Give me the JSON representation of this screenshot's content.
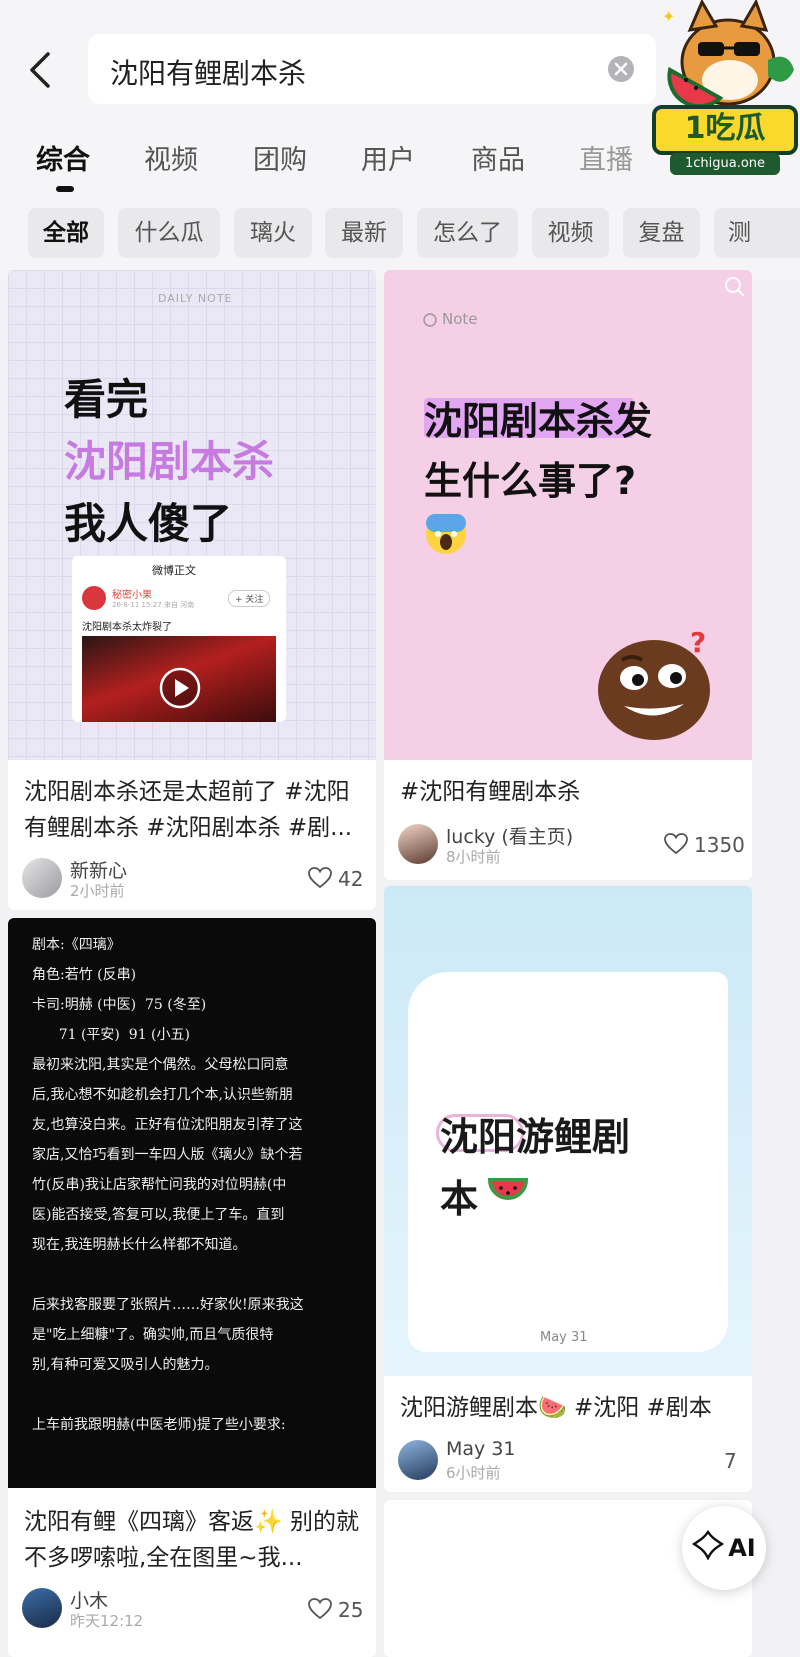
{
  "search": {
    "query": "沈阳有鲤剧本杀"
  },
  "tabs": [
    "综合",
    "视频",
    "团购",
    "用户",
    "商品",
    "直播"
  ],
  "chips": [
    "全部",
    "什么瓜",
    "璃火",
    "最新",
    "怎么了",
    "视频",
    "复盘",
    "测"
  ],
  "logo": {
    "text": "1吃瓜",
    "sub": "1chigua.one"
  },
  "card1": {
    "daily": "DAILY NOTE",
    "line1": "看完",
    "line2": "沈阳剧本杀",
    "line3": "我人傻了",
    "screenshot_header": "微博正文",
    "screenshot_user": "秘密小果",
    "screenshot_meta": "26-8-11 15:27 来自 河南",
    "screenshot_follow": "+ 关注",
    "screenshot_post": "沈阳剧本杀太炸裂了",
    "title": "沈阳剧本杀还是太超前了 #沈阳有鲤剧本杀 #沈阳剧本杀 #剧...",
    "user": "新新心",
    "time": "2小时前",
    "likes": "42"
  },
  "card2": {
    "note": "Note",
    "line1": "沈阳剧本杀发",
    "line2": "生什么事了?",
    "title": "#沈阳有鲤剧本杀",
    "user": "lucky (看主页)",
    "time": "8小时前",
    "likes": "1350"
  },
  "card3": {
    "lines": [
      "剧本:《四璃》",
      "角色:若竹 (反串)",
      "卡司:明赫 (中医)  75 (冬至)",
      "      71 (平安)  91 (小五)",
      "最初来沈阳,其实是个偶然。父母松口同意",
      "后,我心想不如趁机会打几个本,认识些新朋",
      "友,也算没白来。正好有位沈阳朋友引荐了这",
      "家店,又恰巧看到一车四人版《璃火》缺个若",
      "竹(反串)我让店家帮忙问我的对位明赫(中",
      "医)能否接受,答复可以,我便上了车。直到",
      "现在,我连明赫长什么样都不知道。",
      "",
      "后来找客服要了张照片……好家伙!原来我这",
      "是\"吃上细糠\"了。确实帅,而且气质很特",
      "别,有种可爱又吸引人的魅力。",
      "",
      "上车前我跟明赫(中医老师)提了些小要求:"
    ],
    "title": "沈阳有鲤《四璃》客返✨ 别的就不多啰嗦啦,全在图里~我...",
    "user": "小木",
    "time": "昨天12:12",
    "likes": "25"
  },
  "card4": {
    "line1": "沈阳游鲤剧",
    "line2": "本",
    "date": "May 31",
    "title": "沈阳游鲤剧本🍉 #沈阳 #剧本",
    "user": "May 31",
    "time": "6小时前",
    "likes": "7"
  },
  "ai": {
    "label": "AI"
  }
}
